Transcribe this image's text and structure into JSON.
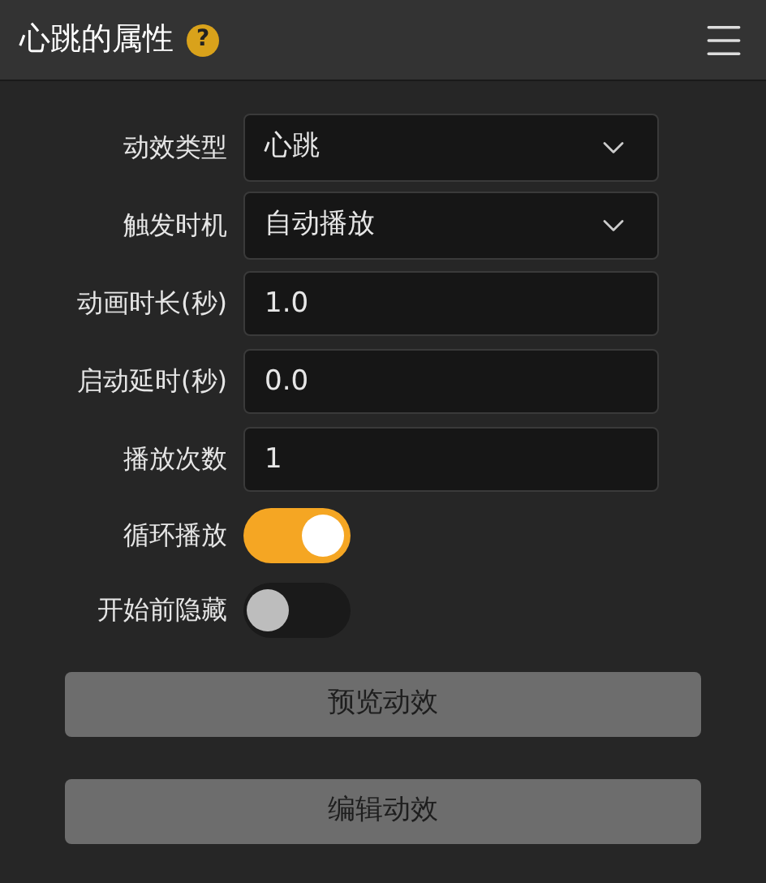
{
  "title": "心跳的属性",
  "help": "?",
  "fields": [
    {
      "kind": "select",
      "label": "动效类型",
      "value": "心跳"
    },
    {
      "kind": "select",
      "label": "触发时机",
      "value": "自动播放"
    },
    {
      "kind": "input",
      "label": "动画时长(秒)",
      "value": "1.0"
    },
    {
      "kind": "input",
      "label": "启动延时(秒)",
      "value": "0.0"
    },
    {
      "kind": "input",
      "label": "播放次数",
      "value": "1"
    }
  ],
  "toggles": [
    {
      "label": "循环播放",
      "on": true
    },
    {
      "label": "开始前隐藏",
      "on": false
    }
  ],
  "buttons": [
    "预览动效",
    "编辑动效"
  ]
}
